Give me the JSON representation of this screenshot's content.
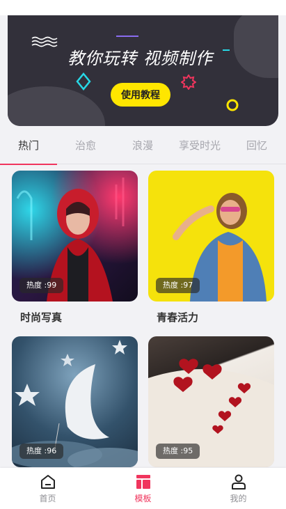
{
  "banner": {
    "title": "教你玩转 视频制作",
    "cta_label": "使用教程",
    "colors": {
      "background": "#32303a",
      "cta": "#ffe600",
      "cyan": "#27d8e6",
      "pink": "#f0355d"
    }
  },
  "tabs": [
    {
      "label": "热门",
      "active": true
    },
    {
      "label": "治愈",
      "active": false
    },
    {
      "label": "浪漫",
      "active": false
    },
    {
      "label": "享受时光",
      "active": false
    },
    {
      "label": "回忆",
      "active": false
    }
  ],
  "cards": [
    {
      "title": "时尚写真",
      "hot": "热度 :99"
    },
    {
      "title": "青春活力",
      "hot": "热度 :97"
    },
    {
      "title": "",
      "hot": "热度 :96"
    },
    {
      "title": "",
      "hot": "热度 :95"
    }
  ],
  "bottom_nav": [
    {
      "label": "首页",
      "icon": "home-icon",
      "active": false
    },
    {
      "label": "模板",
      "icon": "template-icon",
      "active": true
    },
    {
      "label": "我的",
      "icon": "profile-icon",
      "active": false
    }
  ],
  "accent_color": "#f0355d"
}
